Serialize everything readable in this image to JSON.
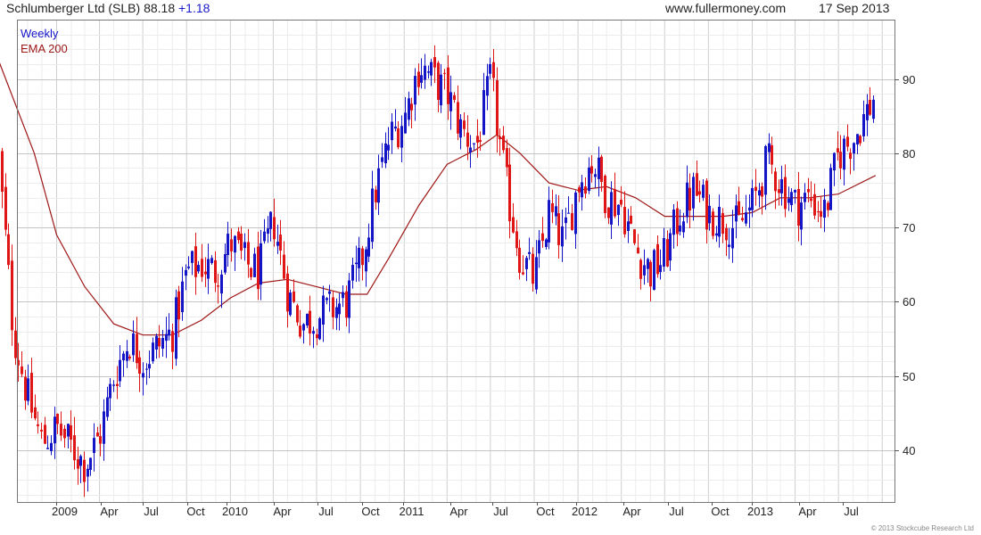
{
  "header": {
    "title": "Schlumberger Ltd (SLB) 88.18",
    "change": "+1.18",
    "website": "www.fullermoney.com",
    "date": "17 Sep 2013"
  },
  "legend": {
    "series1": "Weekly",
    "series2": "EMA 200"
  },
  "footer": {
    "copyright": "© 2013 Stockcube Research Ltd"
  },
  "colors": {
    "up": "#1515c8",
    "down": "#e01515",
    "ema": "#9e1616",
    "grid": "#d4d4d4",
    "frame": "#777777"
  },
  "chart_data": {
    "type": "candlestick",
    "interval": "weekly",
    "ylim": [
      33,
      98
    ],
    "yticks": [
      40,
      50,
      60,
      70,
      80,
      90
    ],
    "grid": true,
    "x_tick_labels": [
      "2009",
      "Apr",
      "Jul",
      "Oct",
      "2010",
      "Apr",
      "Jul",
      "Oct",
      "2011",
      "Apr",
      "Jul",
      "Oct",
      "2012",
      "Apr",
      "Jul",
      "Oct",
      "2013",
      "Apr",
      "Jul"
    ],
    "legend_position": "top-left",
    "series": [
      {
        "name": "Weekly",
        "style": "ohlc-bars",
        "points": [
          {
            "date": "2008-09-01",
            "close": 79
          },
          {
            "date": "2008-10-01",
            "close": 56
          },
          {
            "date": "2008-11-01",
            "close": 47
          },
          {
            "date": "2008-12-01",
            "close": 41
          },
          {
            "date": "2009-01-01",
            "close": 43
          },
          {
            "date": "2009-03-01",
            "close": 38
          },
          {
            "date": "2009-04-01",
            "close": 42
          },
          {
            "date": "2009-05-01",
            "close": 50
          },
          {
            "date": "2009-06-01",
            "close": 55
          },
          {
            "date": "2009-07-01",
            "close": 52
          },
          {
            "date": "2009-08-01",
            "close": 54
          },
          {
            "date": "2009-09-01",
            "close": 56
          },
          {
            "date": "2009-10-01",
            "close": 64
          },
          {
            "date": "2009-11-01",
            "close": 65
          },
          {
            "date": "2009-12-01",
            "close": 64
          },
          {
            "date": "2010-01-01",
            "close": 68
          },
          {
            "date": "2010-02-01",
            "close": 65
          },
          {
            "date": "2010-03-01",
            "close": 64
          },
          {
            "date": "2010-04-01",
            "close": 71
          },
          {
            "date": "2010-05-01",
            "close": 61
          },
          {
            "date": "2010-06-01",
            "close": 57
          },
          {
            "date": "2010-07-01",
            "close": 58
          },
          {
            "date": "2010-08-01",
            "close": 59
          },
          {
            "date": "2010-09-01",
            "close": 60
          },
          {
            "date": "2010-10-01",
            "close": 65
          },
          {
            "date": "2010-11-01",
            "close": 75
          },
          {
            "date": "2010-12-01",
            "close": 82
          },
          {
            "date": "2011-01-01",
            "close": 85
          },
          {
            "date": "2011-02-01",
            "close": 92
          },
          {
            "date": "2011-03-01",
            "close": 90
          },
          {
            "date": "2011-04-01",
            "close": 88
          },
          {
            "date": "2011-05-01",
            "close": 83
          },
          {
            "date": "2011-06-01",
            "close": 81
          },
          {
            "date": "2011-07-01",
            "close": 90
          },
          {
            "date": "2011-08-01",
            "close": 76
          },
          {
            "date": "2011-09-01",
            "close": 66
          },
          {
            "date": "2011-10-01",
            "close": 63
          },
          {
            "date": "2011-11-01",
            "close": 72
          },
          {
            "date": "2011-12-01",
            "close": 68
          },
          {
            "date": "2012-01-01",
            "close": 76
          },
          {
            "date": "2012-02-01",
            "close": 79
          },
          {
            "date": "2012-03-01",
            "close": 74
          },
          {
            "date": "2012-04-01",
            "close": 73
          },
          {
            "date": "2012-05-01",
            "close": 67
          },
          {
            "date": "2012-06-01",
            "close": 64
          },
          {
            "date": "2012-07-01",
            "close": 66
          },
          {
            "date": "2012-08-01",
            "close": 72
          },
          {
            "date": "2012-09-01",
            "close": 75
          },
          {
            "date": "2012-10-01",
            "close": 72
          },
          {
            "date": "2012-11-01",
            "close": 71
          },
          {
            "date": "2012-12-01",
            "close": 70
          },
          {
            "date": "2013-01-01",
            "close": 73
          },
          {
            "date": "2013-02-01",
            "close": 79
          },
          {
            "date": "2013-03-01",
            "close": 76
          },
          {
            "date": "2013-04-01",
            "close": 73
          },
          {
            "date": "2013-05-01",
            "close": 74
          },
          {
            "date": "2013-06-01",
            "close": 72
          },
          {
            "date": "2013-07-01",
            "close": 80
          },
          {
            "date": "2013-08-01",
            "close": 82
          },
          {
            "date": "2013-09-17",
            "close": 88
          }
        ]
      },
      {
        "name": "EMA 200",
        "style": "line",
        "points": [
          {
            "date": "2008-09-01",
            "value": 92.5
          },
          {
            "date": "2008-11-15",
            "value": 80
          },
          {
            "date": "2009-01-01",
            "value": 69
          },
          {
            "date": "2009-03-01",
            "value": 62
          },
          {
            "date": "2009-05-01",
            "value": 57
          },
          {
            "date": "2009-07-01",
            "value": 55.5
          },
          {
            "date": "2009-09-01",
            "value": 55.5
          },
          {
            "date": "2009-11-01",
            "value": 57.5
          },
          {
            "date": "2010-01-01",
            "value": 60.5
          },
          {
            "date": "2010-03-01",
            "value": 62.5
          },
          {
            "date": "2010-05-01",
            "value": 63
          },
          {
            "date": "2010-07-01",
            "value": 62
          },
          {
            "date": "2010-09-01",
            "value": 61
          },
          {
            "date": "2010-10-15",
            "value": 61
          },
          {
            "date": "2010-12-01",
            "value": 66
          },
          {
            "date": "2011-02-01",
            "value": 73
          },
          {
            "date": "2011-04-01",
            "value": 78.5
          },
          {
            "date": "2011-06-01",
            "value": 80.5
          },
          {
            "date": "2011-07-15",
            "value": 82.5
          },
          {
            "date": "2011-09-01",
            "value": 80
          },
          {
            "date": "2011-11-01",
            "value": 76
          },
          {
            "date": "2012-01-01",
            "value": 75
          },
          {
            "date": "2012-03-01",
            "value": 75.5
          },
          {
            "date": "2012-05-01",
            "value": 74
          },
          {
            "date": "2012-07-01",
            "value": 71.5
          },
          {
            "date": "2012-09-01",
            "value": 71.5
          },
          {
            "date": "2012-11-01",
            "value": 71.5
          },
          {
            "date": "2013-01-01",
            "value": 72
          },
          {
            "date": "2013-03-01",
            "value": 74
          },
          {
            "date": "2013-05-01",
            "value": 74
          },
          {
            "date": "2013-07-01",
            "value": 74.5
          },
          {
            "date": "2013-09-17",
            "value": 77
          }
        ]
      }
    ]
  }
}
